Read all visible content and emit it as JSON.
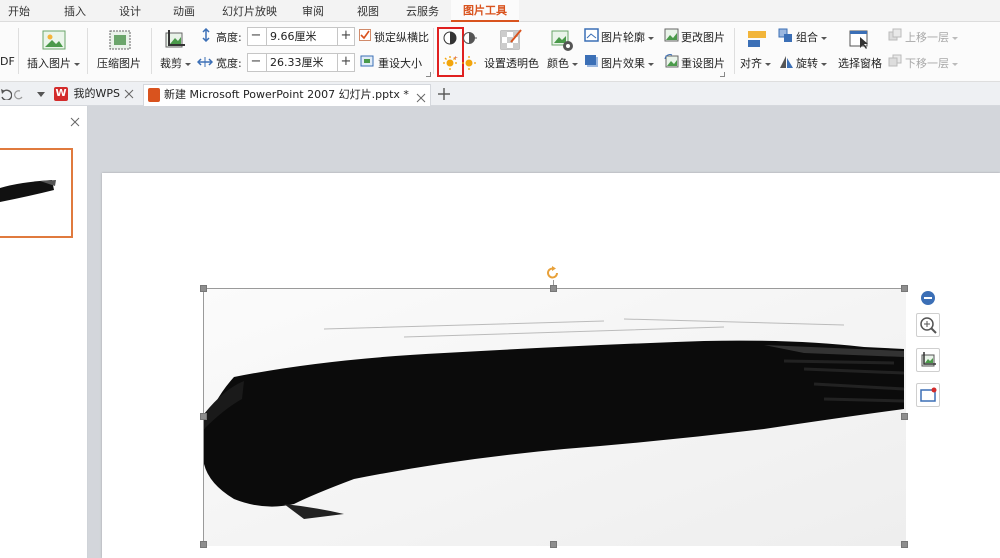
{
  "menu_tabs": [
    "开始",
    "插入",
    "设计",
    "动画",
    "幻灯片放映",
    "审阅",
    "视图",
    "云服务",
    "图片工具"
  ],
  "ribbon": {
    "left_fragment": "DF",
    "insert_picture": "插入图片",
    "compress_picture": "压缩图片",
    "crop": "裁剪",
    "height_label": "高度:",
    "height_value": "9.66厘米",
    "width_label": "宽度:",
    "width_value": "26.33厘米",
    "lock_ratio": "锁定纵横比",
    "reset_size": "重设大小",
    "set_transparent": "设置透明色",
    "color": "颜色",
    "picture_outline": "图片轮廓",
    "picture_effect": "图片效果",
    "change_picture": "更改图片",
    "reset_picture": "重设图片",
    "align": "对齐",
    "group": "组合",
    "rotate": "旋转",
    "selection_pane": "选择窗格",
    "bring_forward": "上移一层",
    "send_backward": "下移一层"
  },
  "doc_tabs": {
    "home_tab": "我的WPS",
    "doc_title": "新建 Microsoft PowerPoint 2007 幻灯片.pptx *"
  },
  "colors": {
    "accent": "#d9531e",
    "highlight_box": "#e02020"
  }
}
